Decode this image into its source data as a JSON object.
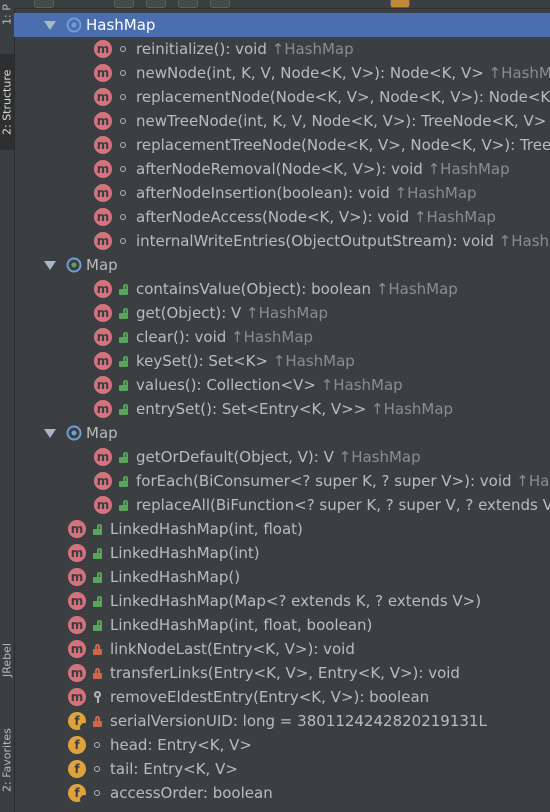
{
  "side_tabs": {
    "project_label": "1: P",
    "structure_label": "2: Structure",
    "jrebel_label": "JRebel",
    "favorites_label": "2: Favorites"
  },
  "tree": {
    "groups": [
      {
        "label": "HashMap",
        "selected": true,
        "items": [
          {
            "name": "reinitialize(): void",
            "origin": "↑HashMap",
            "kind": "method",
            "access": "package"
          },
          {
            "name": "newNode(int, K, V, Node<K, V>): Node<K, V>",
            "origin": "↑HashMap",
            "kind": "method",
            "access": "package"
          },
          {
            "name": "replacementNode(Node<K, V>, Node<K, V>): Node<K, V>",
            "origin": "",
            "kind": "method",
            "access": "package"
          },
          {
            "name": "newTreeNode(int, K, V, Node<K, V>): TreeNode<K, V>",
            "origin": "",
            "kind": "method",
            "access": "package"
          },
          {
            "name": "replacementTreeNode(Node<K, V>, Node<K, V>): Tree",
            "origin": "",
            "kind": "method",
            "access": "package"
          },
          {
            "name": "afterNodeRemoval(Node<K, V>): void",
            "origin": "↑HashMap",
            "kind": "method",
            "access": "package"
          },
          {
            "name": "afterNodeInsertion(boolean): void",
            "origin": "↑HashMap",
            "kind": "method",
            "access": "package"
          },
          {
            "name": "afterNodeAccess(Node<K, V>): void",
            "origin": "↑HashMap",
            "kind": "method",
            "access": "package"
          },
          {
            "name": "internalWriteEntries(ObjectOutputStream): void",
            "origin": "↑HashM",
            "kind": "method",
            "access": "package"
          }
        ]
      },
      {
        "label": "Map",
        "selected": false,
        "items": [
          {
            "name": "containsValue(Object): boolean",
            "origin": "↑HashMap",
            "kind": "method",
            "access": "public"
          },
          {
            "name": "get(Object): V",
            "origin": "↑HashMap",
            "kind": "method",
            "access": "public"
          },
          {
            "name": "clear(): void",
            "origin": "↑HashMap",
            "kind": "method",
            "access": "public"
          },
          {
            "name": "keySet(): Set<K>",
            "origin": "↑HashMap",
            "kind": "method",
            "access": "public"
          },
          {
            "name": "values(): Collection<V>",
            "origin": "↑HashMap",
            "kind": "method",
            "access": "public"
          },
          {
            "name": "entrySet(): Set<Entry<K, V>>",
            "origin": "↑HashMap",
            "kind": "method",
            "access": "public"
          }
        ]
      },
      {
        "label": "Map",
        "selected": false,
        "items": [
          {
            "name": "getOrDefault(Object, V): V",
            "origin": "↑HashMap",
            "kind": "method",
            "access": "public"
          },
          {
            "name": "forEach(BiConsumer<? super K, ? super V>): void",
            "origin": "↑Hashl",
            "kind": "method",
            "access": "public"
          },
          {
            "name": "replaceAll(BiFunction<? super K, ? super V, ? extends V>",
            "origin": "",
            "kind": "method",
            "access": "public"
          }
        ]
      }
    ],
    "members": [
      {
        "name": "LinkedHashMap(int, float)",
        "kind": "method",
        "access": "public"
      },
      {
        "name": "LinkedHashMap(int)",
        "kind": "method",
        "access": "public"
      },
      {
        "name": "LinkedHashMap()",
        "kind": "method",
        "access": "public"
      },
      {
        "name": "LinkedHashMap(Map<? extends K, ? extends V>)",
        "kind": "method",
        "access": "public"
      },
      {
        "name": "LinkedHashMap(int, float, boolean)",
        "kind": "method",
        "access": "public"
      },
      {
        "name": "linkNodeLast(Entry<K, V>): void",
        "kind": "method",
        "access": "private"
      },
      {
        "name": "transferLinks(Entry<K, V>, Entry<K, V>): void",
        "kind": "method",
        "access": "private"
      },
      {
        "name": "removeEldestEntry(Entry<K, V>): boolean",
        "kind": "method",
        "access": "protected"
      },
      {
        "name": "serialVersionUID: long = 3801124242820219131L",
        "kind": "field-static",
        "access": "private"
      },
      {
        "name": "head: Entry<K, V>",
        "kind": "field",
        "access": "package"
      },
      {
        "name": "tail: Entry<K, V>",
        "kind": "field",
        "access": "package"
      },
      {
        "name": "accessOrder: boolean",
        "kind": "field-final",
        "access": "package"
      }
    ]
  },
  "colors": {
    "background": "#3c3f41",
    "selection": "#4b6eaf",
    "method_icon": "#d7727c",
    "field_icon": "#e0a33c",
    "public_lock": "#58a55c",
    "private_lock": "#d0674a",
    "text": "#bbbbbb"
  }
}
